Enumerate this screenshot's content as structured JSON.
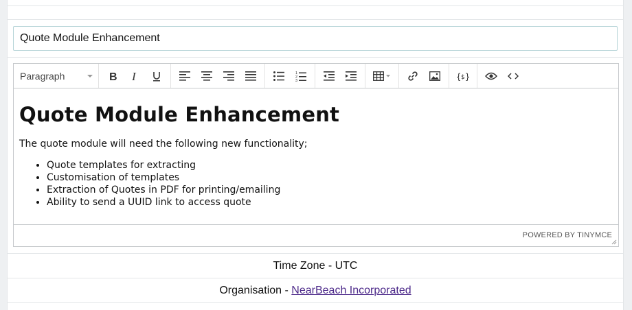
{
  "title_field": {
    "value": "Quote Module Enhancement"
  },
  "editor": {
    "toolbar": {
      "format_select": "Paragraph",
      "buttons": [
        "bold-icon",
        "italic-icon",
        "underline-icon",
        "align-left-icon",
        "align-center-icon",
        "align-right-icon",
        "align-justify-icon",
        "bullet-list-icon",
        "numbered-list-icon",
        "outdent-icon",
        "indent-icon",
        "table-icon",
        "link-icon",
        "image-icon",
        "template-variable-icon",
        "preview-icon",
        "source-code-icon"
      ]
    },
    "content": {
      "heading": "Quote Module Enhancement",
      "paragraph": "The quote module will need the following new functionality;",
      "bullets": [
        "Quote templates for extracting",
        "Customisation of templates",
        "Extraction of Quotes in PDF for printing/emailing",
        "Ability to send a UUID link to access quote"
      ]
    },
    "powered_by": "POWERED BY TINYMCE"
  },
  "timezone": {
    "text": "Time Zone - UTC"
  },
  "organisation": {
    "label": "Organisation - ",
    "link_text": "NearBeach Incorporated"
  },
  "colors": {
    "link": "#4d2a8a",
    "input_border": "#b6d4d8",
    "background": "#eef0f2"
  }
}
